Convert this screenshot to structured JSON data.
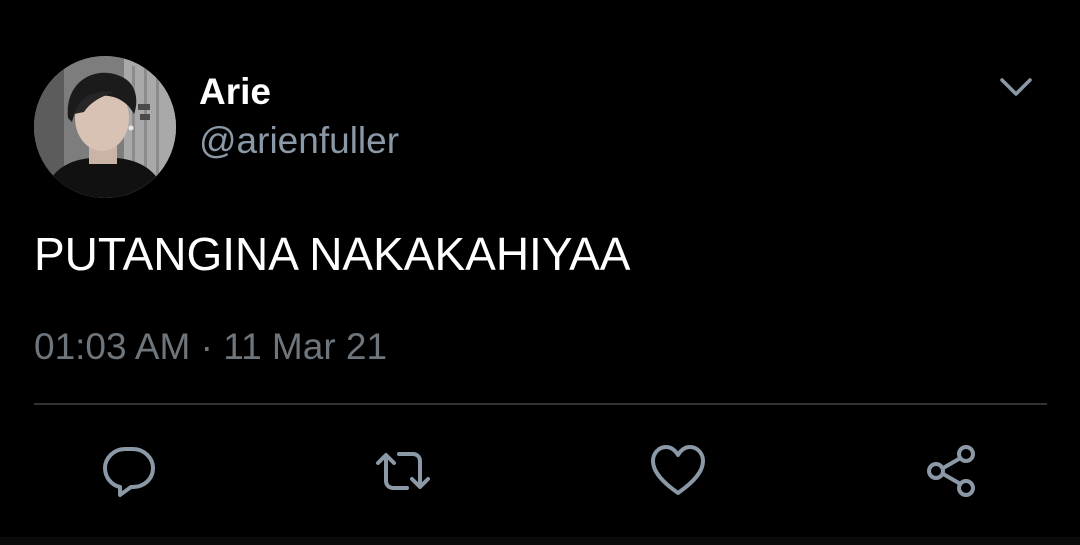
{
  "tweet": {
    "author": {
      "display_name": "Arie",
      "handle": "@arienfuller"
    },
    "text": "PUTANGINA NAKAKAHIYAA",
    "time": "01:03 AM",
    "separator": "·",
    "date": "11 Mar 21"
  },
  "icons": {
    "menu": "chevron-down-icon",
    "reply": "reply-icon",
    "retweet": "retweet-icon",
    "like": "heart-icon",
    "share": "share-icon"
  },
  "colors": {
    "background": "#000000",
    "primary_text": "#ffffff",
    "secondary_text": "#8b98a5",
    "meta_text": "#6e767d",
    "icon": "#8b98a5",
    "divider": "#2f3336"
  }
}
